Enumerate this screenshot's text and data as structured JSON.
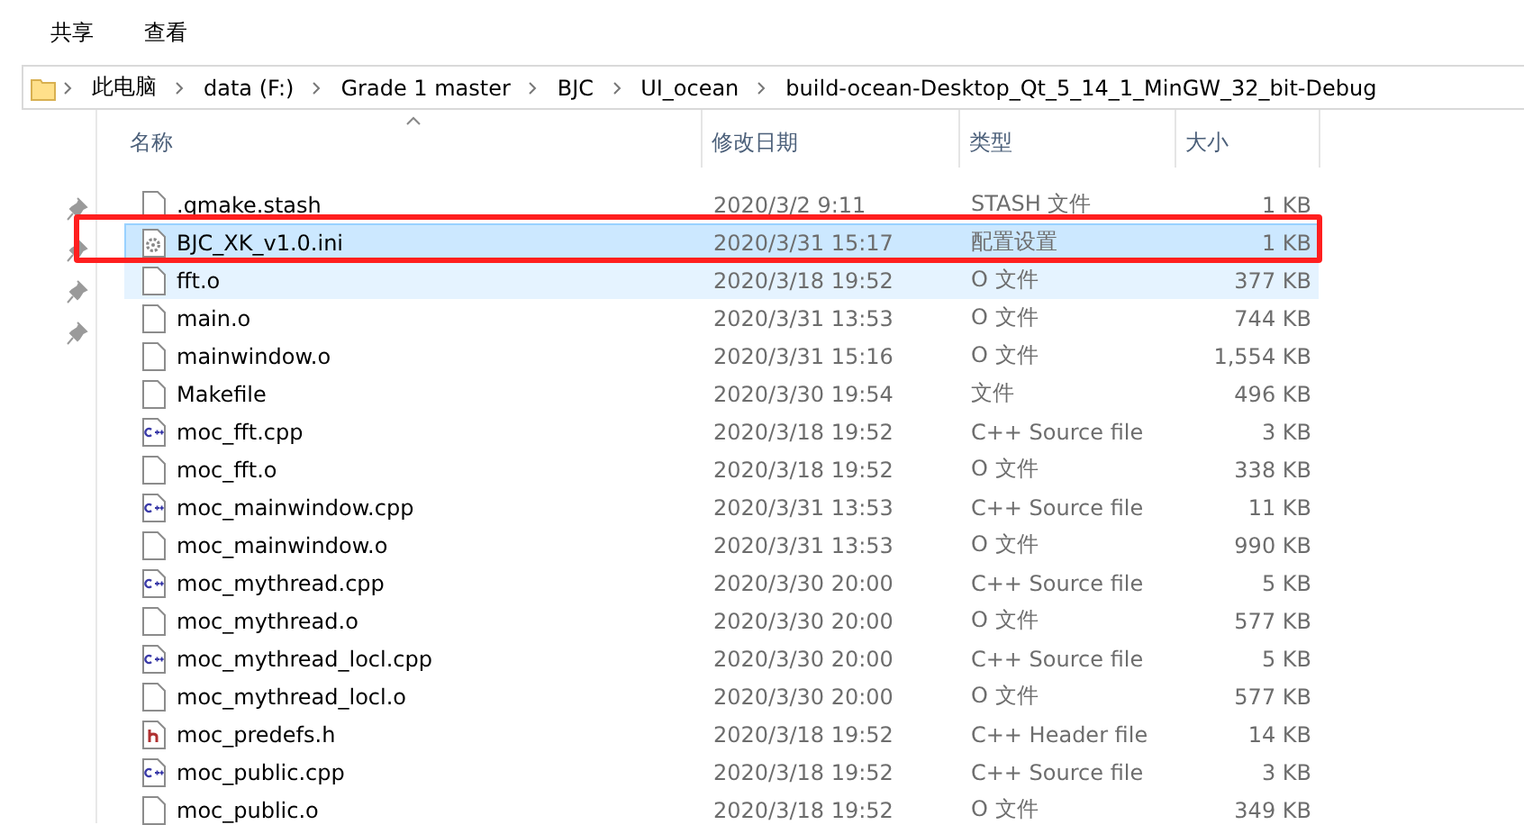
{
  "ribbon_tabs": [
    {
      "label": "共享"
    },
    {
      "label": "查看"
    }
  ],
  "address_bar": {
    "path": [
      "此电脑",
      "data (F:)",
      "Grade 1 master",
      "BJC",
      "UI_ocean",
      "build-ocean-Desktop_Qt_5_14_1_MinGW_32_bit-Debug"
    ]
  },
  "columns": [
    {
      "label": "名称",
      "sorted": true
    },
    {
      "label": "修改日期",
      "sorted": false
    },
    {
      "label": "类型",
      "sorted": false
    },
    {
      "label": "大小",
      "sorted": false
    }
  ],
  "files": [
    {
      "kind": "blank",
      "name": ".qmake.stash",
      "date": "2020/3/2 9:11",
      "type": "STASH 文件",
      "size": "1 KB",
      "selected": false,
      "hovered": false
    },
    {
      "kind": "config",
      "name": "BJC_XK_v1.0.ini",
      "date": "2020/3/31 15:17",
      "type": "配置设置",
      "size": "1 KB",
      "selected": true,
      "hovered": false
    },
    {
      "kind": "blank",
      "name": "fft.o",
      "date": "2020/3/18 19:52",
      "type": "O 文件",
      "size": "377 KB",
      "selected": false,
      "hovered": true
    },
    {
      "kind": "blank",
      "name": "main.o",
      "date": "2020/3/31 13:53",
      "type": "O 文件",
      "size": "744 KB",
      "selected": false,
      "hovered": false
    },
    {
      "kind": "blank",
      "name": "mainwindow.o",
      "date": "2020/3/31 15:16",
      "type": "O 文件",
      "size": "1,554 KB",
      "selected": false,
      "hovered": false
    },
    {
      "kind": "blank",
      "name": "Makefile",
      "date": "2020/3/30 19:54",
      "type": "文件",
      "size": "496 KB",
      "selected": false,
      "hovered": false
    },
    {
      "kind": "cpp",
      "name": "moc_fft.cpp",
      "date": "2020/3/18 19:52",
      "type": "C++ Source file",
      "size": "3 KB",
      "selected": false,
      "hovered": false
    },
    {
      "kind": "blank",
      "name": "moc_fft.o",
      "date": "2020/3/18 19:52",
      "type": "O 文件",
      "size": "338 KB",
      "selected": false,
      "hovered": false
    },
    {
      "kind": "cpp",
      "name": "moc_mainwindow.cpp",
      "date": "2020/3/31 13:53",
      "type": "C++ Source file",
      "size": "11 KB",
      "selected": false,
      "hovered": false
    },
    {
      "kind": "blank",
      "name": "moc_mainwindow.o",
      "date": "2020/3/31 13:53",
      "type": "O 文件",
      "size": "990 KB",
      "selected": false,
      "hovered": false
    },
    {
      "kind": "cpp",
      "name": "moc_mythread.cpp",
      "date": "2020/3/30 20:00",
      "type": "C++ Source file",
      "size": "5 KB",
      "selected": false,
      "hovered": false
    },
    {
      "kind": "blank",
      "name": "moc_mythread.o",
      "date": "2020/3/30 20:00",
      "type": "O 文件",
      "size": "577 KB",
      "selected": false,
      "hovered": false
    },
    {
      "kind": "cpp",
      "name": "moc_mythread_locl.cpp",
      "date": "2020/3/30 20:00",
      "type": "C++ Source file",
      "size": "5 KB",
      "selected": false,
      "hovered": false
    },
    {
      "kind": "blank",
      "name": "moc_mythread_locl.o",
      "date": "2020/3/30 20:00",
      "type": "O 文件",
      "size": "577 KB",
      "selected": false,
      "hovered": false
    },
    {
      "kind": "header",
      "name": "moc_predefs.h",
      "date": "2020/3/18 19:52",
      "type": "C++ Header file",
      "size": "14 KB",
      "selected": false,
      "hovered": false
    },
    {
      "kind": "cpp",
      "name": "moc_public.cpp",
      "date": "2020/3/18 19:52",
      "type": "C++ Source file",
      "size": "3 KB",
      "selected": false,
      "hovered": false
    },
    {
      "kind": "blank",
      "name": "moc_public.o",
      "date": "2020/3/18 19:52",
      "type": "O 文件",
      "size": "349 KB",
      "selected": false,
      "hovered": false
    }
  ],
  "annotation": {
    "highlight_box": true
  }
}
